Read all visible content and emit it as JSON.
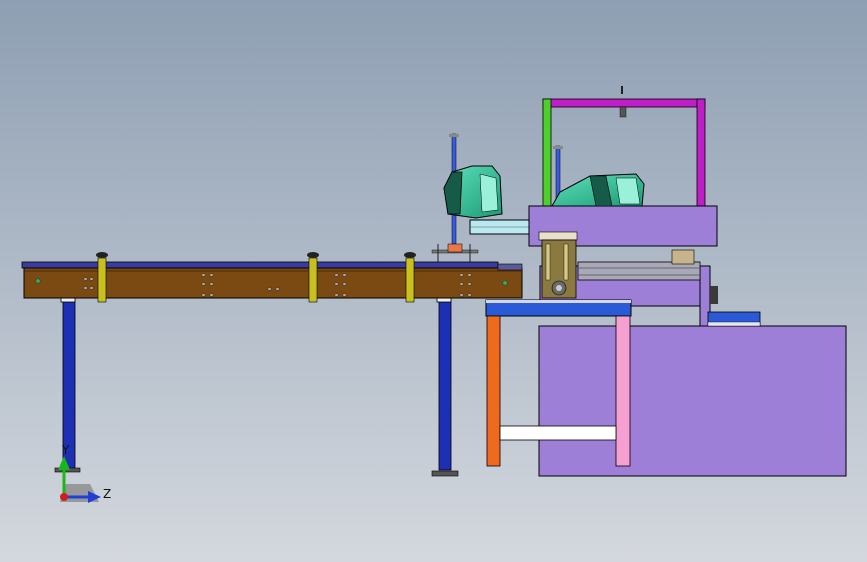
{
  "viewport": {
    "background_top": "#8e9fb3",
    "background_bottom": "#d4d8de"
  },
  "triad": {
    "y_label": "Y",
    "z_label": "Z",
    "y_color": "#19b819",
    "z_color": "#1f3fd6",
    "origin_color": "#d41c1c"
  },
  "colors": {
    "conveyor_top": "#3b3b9e",
    "conveyor_body": "#7a4a12",
    "leg_blue": "#1d2fb5",
    "station_purple": "#9d7fd8",
    "station_outline": "#3a2a6a",
    "table_top": "#2a5ad6",
    "leg_orange": "#f06a1e",
    "leg_pink": "#f5a0d0",
    "frame_magenta": "#c01ec8",
    "frame_green": "#4ed02a",
    "robot_teal": "#2fc79a",
    "robot_dark": "#165a48",
    "arm_light": "#b9e8ee",
    "bracket_yellow": "#c8c01e",
    "gearbox_olive": "#8a7a40",
    "blue_pin": "#3a5ae0"
  }
}
